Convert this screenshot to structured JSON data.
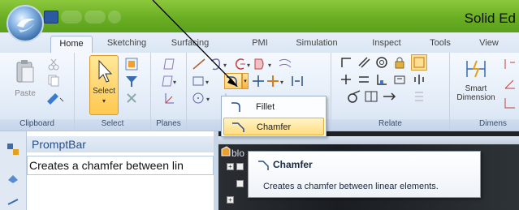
{
  "app_title": "Solid Ed",
  "tabs": [
    "Home",
    "Sketching",
    "Surfacing",
    "PMI",
    "Simulation",
    "Inspect",
    "Tools",
    "View"
  ],
  "groups": {
    "clipboard": "Clipboard",
    "select": "Select",
    "planes": "Planes",
    "relate": "Relate",
    "dimension": "Dimens"
  },
  "buttons": {
    "paste": "Paste",
    "select": "Select",
    "smart_dimension_line1": "Smart",
    "smart_dimension_line2": "Dimension"
  },
  "menu": {
    "items": [
      "Fillet",
      "Chamfer"
    ],
    "highlighted": "Chamfer"
  },
  "promptbar": {
    "title": "PromptBar",
    "text": "Creates a chamfer between lin"
  },
  "tree": {
    "label": "blo"
  },
  "tooltip": {
    "title": "Chamfer",
    "text": "Creates a chamfer between linear elements."
  },
  "colors": {
    "titlebar": "#6aae24",
    "ribbon": "#e4edf8",
    "highlight": "#ffdd80",
    "promptbar_title": "#2a4f86"
  }
}
